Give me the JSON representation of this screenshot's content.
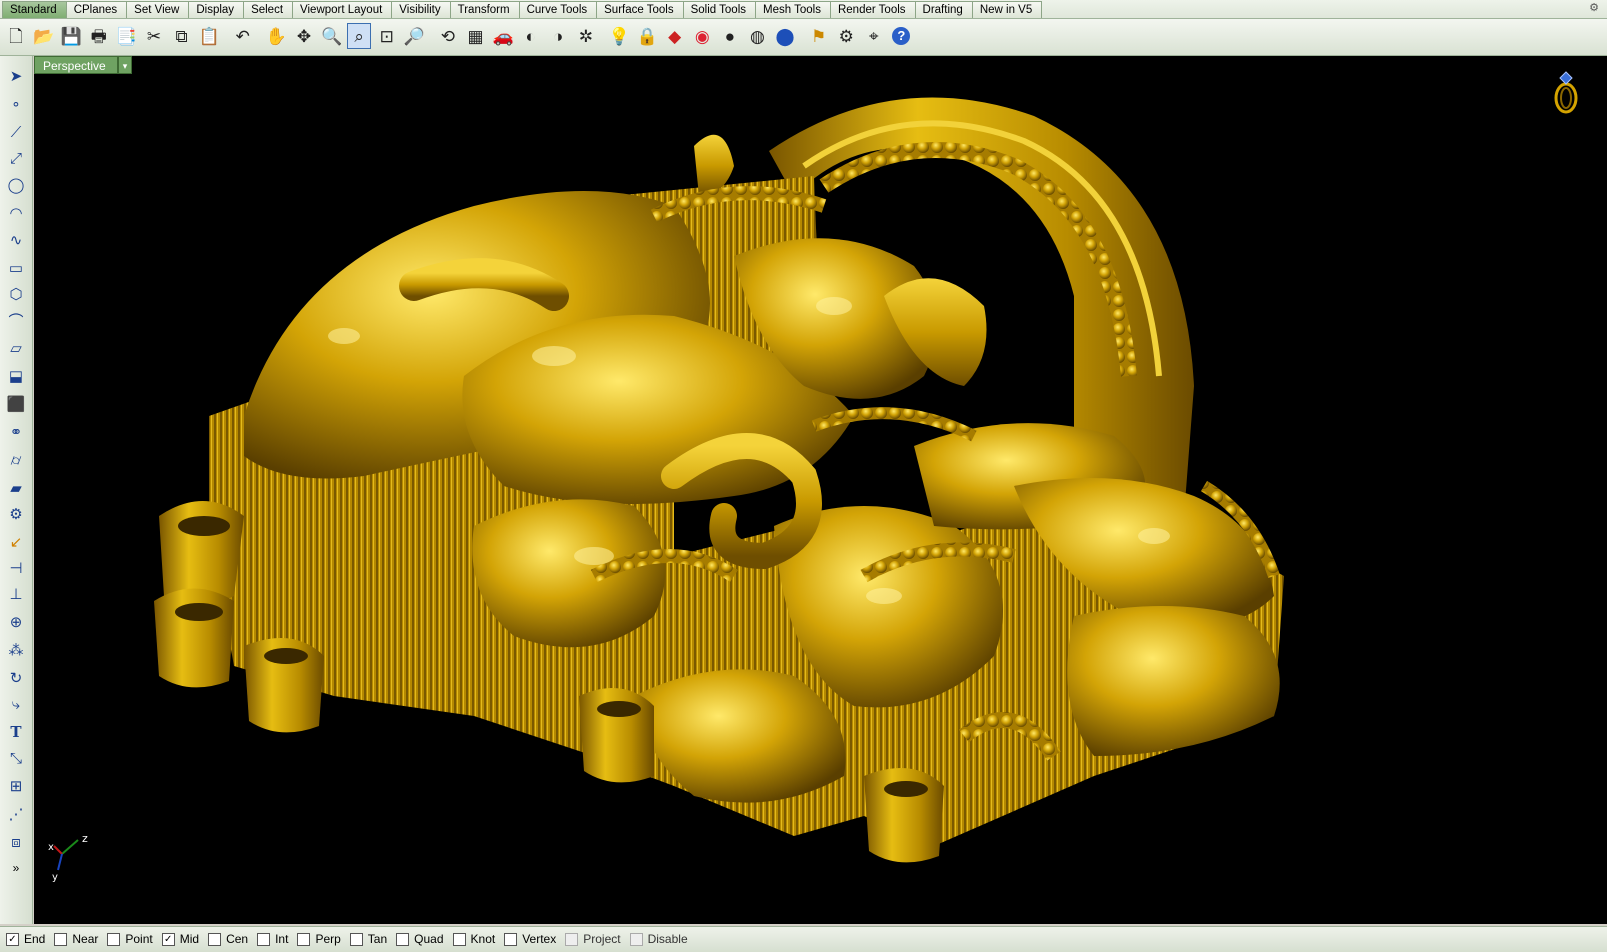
{
  "tabs": [
    "Standard",
    "CPlanes",
    "Set View",
    "Display",
    "Select",
    "Viewport Layout",
    "Visibility",
    "Transform",
    "Curve Tools",
    "Surface Tools",
    "Solid Tools",
    "Mesh Tools",
    "Render Tools",
    "Drafting",
    "New in V5"
  ],
  "active_tab": "Standard",
  "toolbar_icons": [
    "new-file",
    "open-file",
    "save",
    "print",
    "import",
    "cut",
    "copy",
    "paste",
    "undo",
    "pan",
    "rotate-view",
    "zoom",
    "zoom-window",
    "zoom-extents",
    "zoom-selected",
    "rotate-3d",
    "viewport-layout",
    "car-render",
    "hide-object",
    "show-object",
    "isolate",
    "light-bulb",
    "lock",
    "layer",
    "color-wheel",
    "shade-sphere",
    "render-sphere",
    "blue-sphere",
    "flag",
    "options-gear",
    "snapshot",
    "help"
  ],
  "left_toolbar_icons": [
    "select-arrow",
    "point",
    "polyline",
    "line",
    "circle",
    "arc",
    "curve",
    "rectangle",
    "polygon",
    "fillet-curve",
    "surface",
    "extrude",
    "box",
    "solid-union",
    "cylinder",
    "planar-surface",
    "gear-settings",
    "transform-arrow",
    "dimension",
    "plane",
    "boolean",
    "array-dots",
    "rotate",
    "bend",
    "text",
    "scale",
    "group",
    "edit-points",
    "block-cube",
    "more"
  ],
  "viewport": {
    "label": "Perspective",
    "dropdown": "▾",
    "background": "#000000",
    "model_color": "#c9a000"
  },
  "axis_labels": {
    "z": "z",
    "x": "x",
    "y": "y"
  },
  "osnaps": [
    {
      "label": "End",
      "checked": true,
      "enabled": true
    },
    {
      "label": "Near",
      "checked": false,
      "enabled": true
    },
    {
      "label": "Point",
      "checked": false,
      "enabled": true
    },
    {
      "label": "Mid",
      "checked": true,
      "enabled": true
    },
    {
      "label": "Cen",
      "checked": false,
      "enabled": true
    },
    {
      "label": "Int",
      "checked": false,
      "enabled": true
    },
    {
      "label": "Perp",
      "checked": false,
      "enabled": true
    },
    {
      "label": "Tan",
      "checked": false,
      "enabled": true
    },
    {
      "label": "Quad",
      "checked": false,
      "enabled": true
    },
    {
      "label": "Knot",
      "checked": false,
      "enabled": true
    },
    {
      "label": "Vertex",
      "checked": false,
      "enabled": true
    },
    {
      "label": "Project",
      "checked": false,
      "enabled": false
    },
    {
      "label": "Disable",
      "checked": false,
      "enabled": false
    }
  ]
}
